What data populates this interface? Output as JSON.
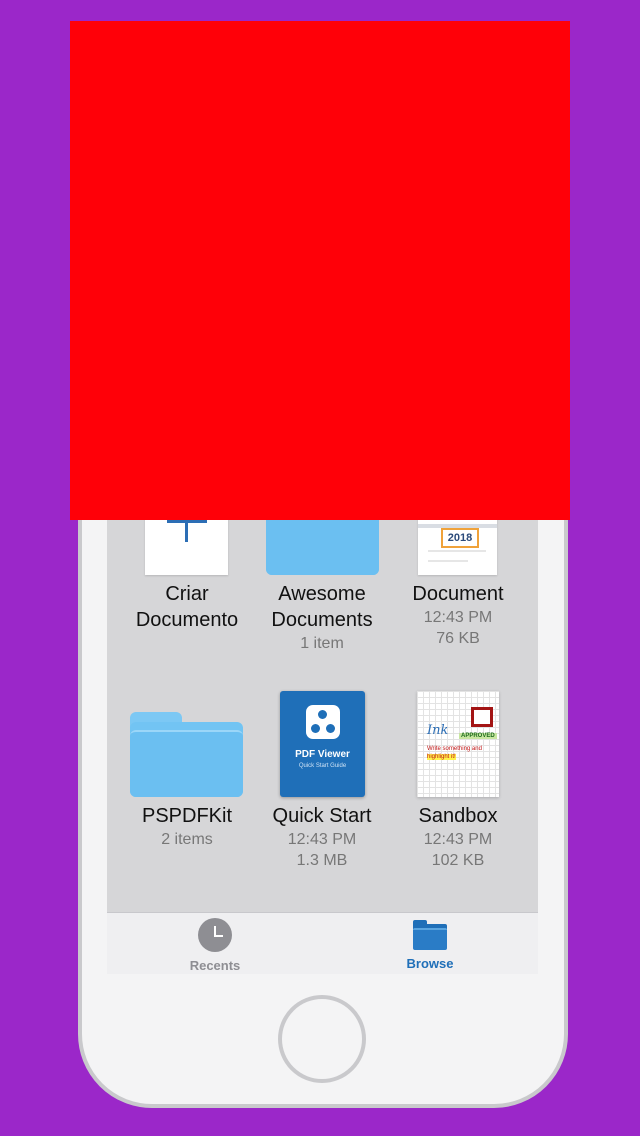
{
  "grid": {
    "items": [
      {
        "name_line1": "Criar",
        "name_line2": "Documento"
      },
      {
        "name_line1": "Awesome",
        "name_line2": "Documents",
        "meta1": "1 item"
      },
      {
        "name_line1": "Document",
        "meta1": "12:43 PM",
        "meta2": "76 KB",
        "thumb_text": "2018"
      },
      {
        "name_line1": "PSPDFKit",
        "meta1": "2 items"
      },
      {
        "name_line1": "Quick Start",
        "meta1": "12:43 PM",
        "meta2": "1.3 MB",
        "thumb_title": "PDF Viewer",
        "thumb_subtitle": "Quick Start Guide"
      },
      {
        "name_line1": "Sandbox",
        "meta1": "12:43 PM",
        "meta2": "102 KB",
        "thumb_approved": "APPROVED",
        "thumb_ink": "Ink",
        "thumb_write": "Write something and",
        "thumb_highlight": "highlight it!"
      }
    ]
  },
  "tabbar": {
    "recents_label": "Recents",
    "browse_label": "Browse"
  },
  "colors": {
    "background": "#9b27c9",
    "overlay": "#ff0008",
    "accent": "#1f6fb8",
    "folder": "#72c4f3"
  }
}
